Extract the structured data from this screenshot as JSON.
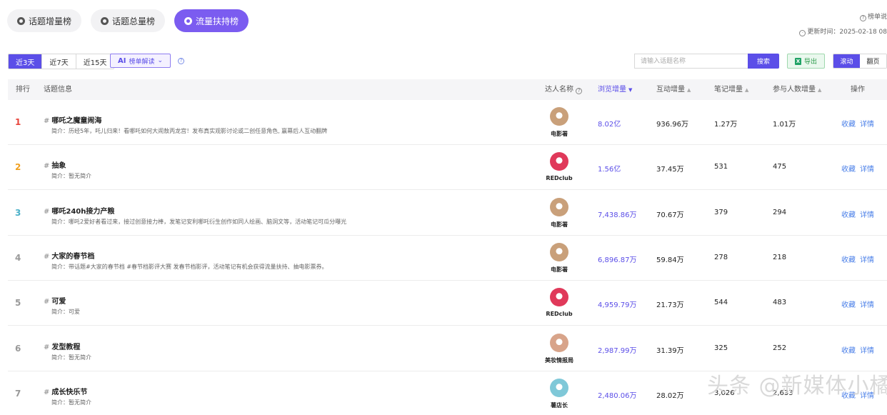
{
  "top_tabs": [
    {
      "label": "话题增量榜",
      "active": false
    },
    {
      "label": "话题总量榜",
      "active": false
    },
    {
      "label": "流量扶持榜",
      "active": true
    }
  ],
  "top_right": {
    "rule_label": "榜单说",
    "update_label": "更新时间：2025-02-18 08"
  },
  "range_buttons": [
    {
      "label": "近3天",
      "active": true
    },
    {
      "label": "近7天",
      "active": false
    },
    {
      "label": "近15天",
      "active": false
    }
  ],
  "ai_button": {
    "mark": "AI",
    "label": "榜单解读",
    "caret": "⌄"
  },
  "search": {
    "placeholder": "请输入话题名称",
    "button_label": "搜索"
  },
  "export": {
    "icon": "X",
    "label": "导出"
  },
  "view_modes": [
    {
      "label": "滚动",
      "active": true
    },
    {
      "label": "翻页",
      "active": false
    }
  ],
  "columns": {
    "rank": "排行",
    "topic": "话题信息",
    "creator": "达人名称",
    "views": "浏览增量",
    "interactions": "互动增量",
    "notes": "笔记增量",
    "participants": "参与人数增量",
    "actions": "操作"
  },
  "action_labels": {
    "favorite": "收藏",
    "detail": "详情"
  },
  "rows": [
    {
      "rank": "1",
      "title": "哪吒之魔童闹海",
      "desc": "简介：历经5年，吒儿归来！看哪吒如何大闹敖丙龙宫！发布真实观影讨论或二创任意角色, 赢幕后人互动翻牌",
      "creator": "电影署",
      "views": "8.02亿",
      "interactions": "936.96万",
      "notes": "1.27万",
      "participants": "1.01万",
      "rank_color": "#e8453c",
      "avatar_color": "#c9a07a"
    },
    {
      "rank": "2",
      "title": "抽象",
      "desc": "简介：暂无简介",
      "creator": "REDclub",
      "views": "1.56亿",
      "interactions": "37.45万",
      "notes": "531",
      "participants": "475",
      "rank_color": "#f0a020",
      "avatar_color": "#e0395a"
    },
    {
      "rank": "3",
      "title": "哪吒240h接力产粮",
      "desc": "简介：哪吒2爱好者看过来，接过创意接力棒，发笔记安利哪吒衍生创作如同人绘画、脑洞文等，活动笔记可瓜分曝光",
      "creator": "电影署",
      "views": "7,438.86万",
      "interactions": "70.67万",
      "notes": "379",
      "participants": "294",
      "rank_color": "#4ab0c8",
      "avatar_color": "#c9a07a"
    },
    {
      "rank": "4",
      "title": "大家的春节档",
      "desc": "简介：带话题#大家的春节档 #春节档影评大赛 发春节档影评，活动笔记有机会获得流量扶持、抽电影票券。",
      "creator": "电影署",
      "views": "6,896.87万",
      "interactions": "59.84万",
      "notes": "278",
      "participants": "218",
      "rank_color": "#999999",
      "avatar_color": "#c9a07a"
    },
    {
      "rank": "5",
      "title": "可爱",
      "desc": "简介：可爱",
      "creator": "REDclub",
      "views": "4,959.79万",
      "interactions": "21.73万",
      "notes": "544",
      "participants": "483",
      "rank_color": "#999999",
      "avatar_color": "#e0395a"
    },
    {
      "rank": "6",
      "title": "发型教程",
      "desc": "简介：暂无简介",
      "creator": "美妆情报局",
      "views": "2,987.99万",
      "interactions": "31.39万",
      "notes": "325",
      "participants": "252",
      "rank_color": "#999999",
      "avatar_color": "#d8a48a"
    },
    {
      "rank": "7",
      "title": "成长快乐节",
      "desc": "简介：暂无简介",
      "creator": "薯店长",
      "views": "2,480.06万",
      "interactions": "28.02万",
      "notes": "3,026",
      "participants": "2,633",
      "rank_color": "#999999",
      "avatar_color": "#7fc8d8"
    }
  ],
  "watermark": "头条 @新媒体小橘"
}
